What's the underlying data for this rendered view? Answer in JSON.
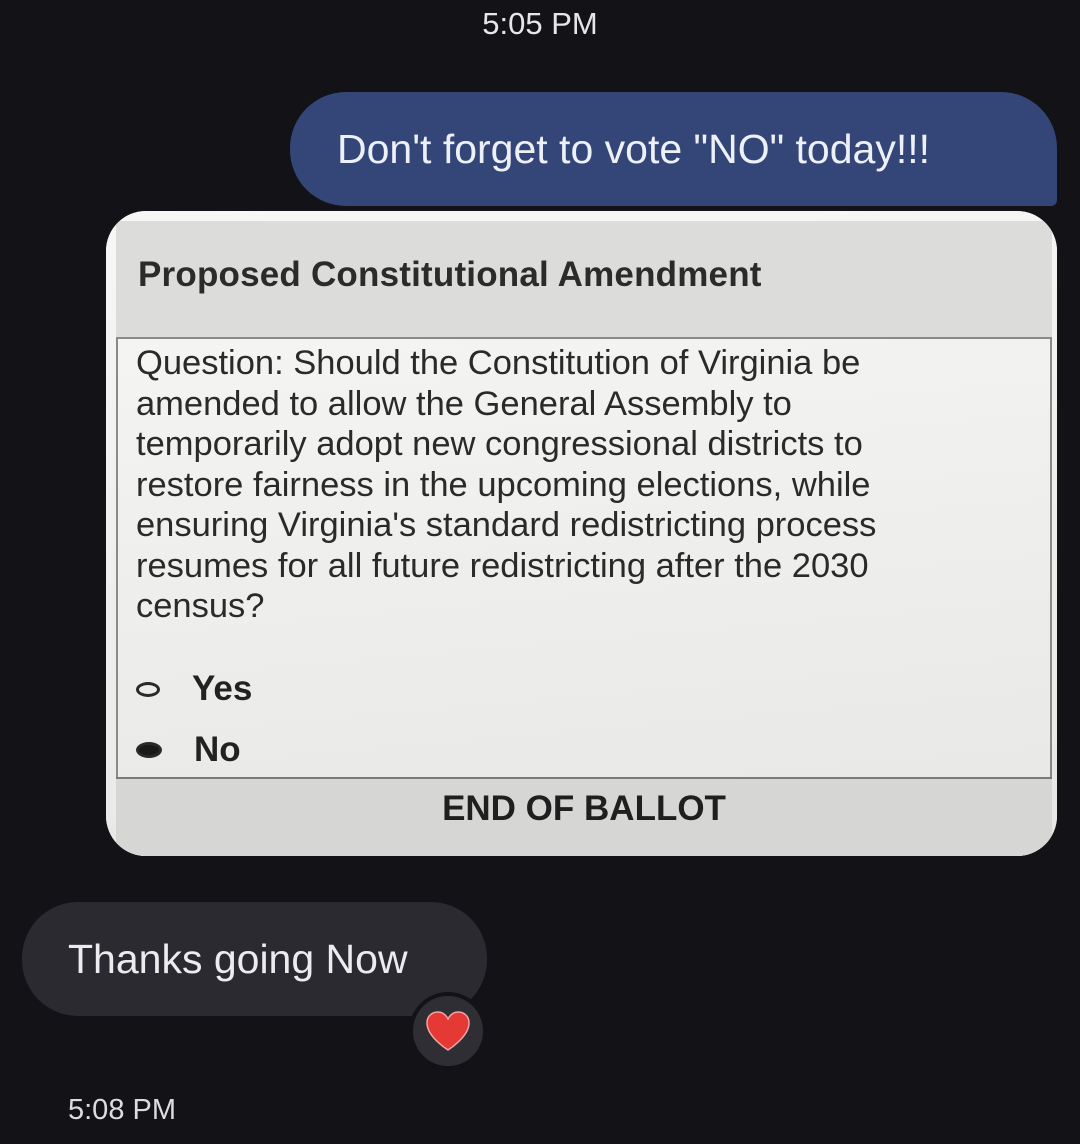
{
  "conversation": {
    "sent_time": "5:05 PM",
    "sent_message": "Don't forget to vote \"NO\" today!!!",
    "received_message": "Thanks going Now",
    "received_time": "5:08 PM",
    "reaction": "heart-icon",
    "colors": {
      "background": "#121217",
      "sent_bubble": "#334677",
      "received_bubble": "#2a2a30",
      "reaction_heart": "#e53935"
    }
  },
  "ballot_image": {
    "title": "Proposed Constitutional Amendment",
    "question": "Question: Should the Constitution of Virginia be\namended to allow the General Assembly to\ntemporarily adopt new congressional districts to\nrestore fairness in the upcoming elections, while\nensuring Virginia's standard redistricting process\nresumes for all future redistricting after the 2030\ncensus?",
    "options": [
      {
        "label": "Yes",
        "selected": false
      },
      {
        "label": "No",
        "selected": true
      }
    ],
    "footer": "END OF BALLOT"
  }
}
